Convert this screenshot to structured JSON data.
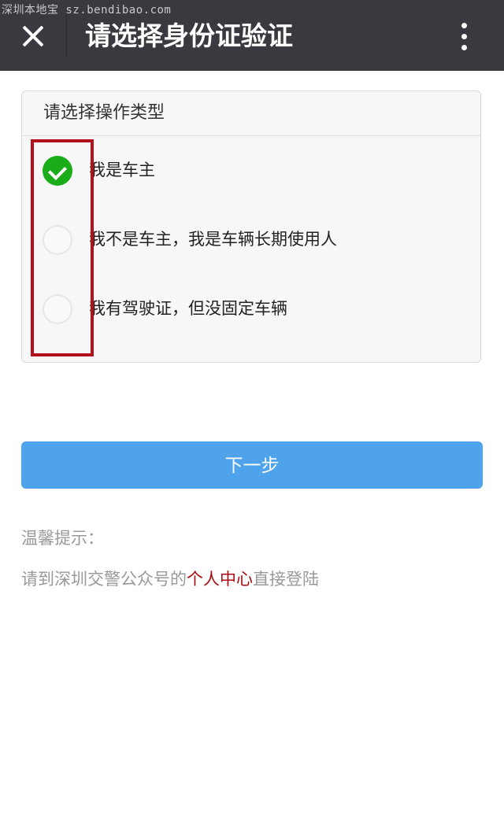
{
  "watermark": "深圳本地宝 sz.bendibao.com",
  "header": {
    "title": "请选择身份证验证",
    "close_icon": "close-icon",
    "more_icon": "more-vertical-icon"
  },
  "panel": {
    "title": "请选择操作类型",
    "options": [
      {
        "label": "我是车主",
        "checked": true
      },
      {
        "label": "我不是车主，我是车辆长期使用人",
        "checked": false
      },
      {
        "label": "我有驾驶证，但没固定车辆",
        "checked": false
      }
    ]
  },
  "next_button": {
    "label": "下一步"
  },
  "tips": {
    "title": "温馨提示：",
    "body_prefix": "请到深圳交警公众号的",
    "body_link": "个人中心",
    "body_suffix": "直接登陆"
  },
  "colors": {
    "topbar": "#393a3f",
    "check_green": "#1aad19",
    "button_blue": "#4ea3ea",
    "highlight_red": "#b3111c",
    "link_red": "#a80c12"
  }
}
